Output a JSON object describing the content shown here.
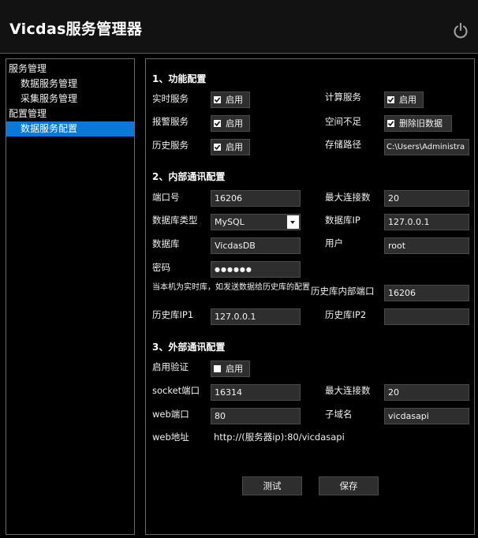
{
  "app": {
    "title": "Vicdas服务管理器"
  },
  "sidebar": {
    "items": [
      {
        "label": "服务管理"
      },
      {
        "label": "数据服务管理"
      },
      {
        "label": "采集服务管理"
      },
      {
        "label": "配置管理"
      },
      {
        "label": "数据服务配置"
      }
    ]
  },
  "section1": {
    "title": "1、功能配置",
    "realtime_label": "实时服务",
    "realtime_check": "启用",
    "realtime_checked": true,
    "compute_label": "计算服务",
    "compute_check": "启用",
    "compute_checked": true,
    "alarm_label": "报警服务",
    "alarm_check": "启用",
    "alarm_checked": true,
    "space_label": "空间不足",
    "space_check": "删除旧数据",
    "space_checked": true,
    "history_label": "历史服务",
    "history_check": "启用",
    "history_checked": true,
    "storage_label": "存储路径",
    "storage_value": "C:\\Users\\Administra"
  },
  "section2": {
    "title": "2、内部通讯配置",
    "port_label": "端口号",
    "port_value": "16206",
    "maxconn_label": "最大连接数",
    "maxconn_value": "20",
    "dbtype_label": "数据库类型",
    "dbtype_value": "MySQL",
    "dbip_label": "数据库IP",
    "dbip_value": "127.0.0.1",
    "db_label": "数据库",
    "db_value": "VicdasDB",
    "user_label": "用户",
    "user_value": "root",
    "pwd_label": "密码",
    "pwd_value": "●●●●●●",
    "note": "当本机为实时库，如发送数据给历史库的配置",
    "histport_label": "历史库内部端口",
    "histport_value": "16206",
    "histip1_label": "历史库IP1",
    "histip1_value": "127.0.0.1",
    "histip2_label": "历史库IP2",
    "histip2_value": ""
  },
  "section3": {
    "title": "3、外部通讯配置",
    "auth_label": "启用验证",
    "auth_check": "启用",
    "auth_checked": false,
    "socket_label": "socket端口",
    "socket_value": "16314",
    "maxconn_label": "最大连接数",
    "maxconn_value": "20",
    "web_label": "web端口",
    "web_value": "80",
    "subdomain_label": "子域名",
    "subdomain_value": "vicdasapi",
    "url_label": "web地址",
    "url_value": "http://(服务器ip):80/vicdasapi"
  },
  "actions": {
    "test": "测试",
    "save": "保存"
  }
}
